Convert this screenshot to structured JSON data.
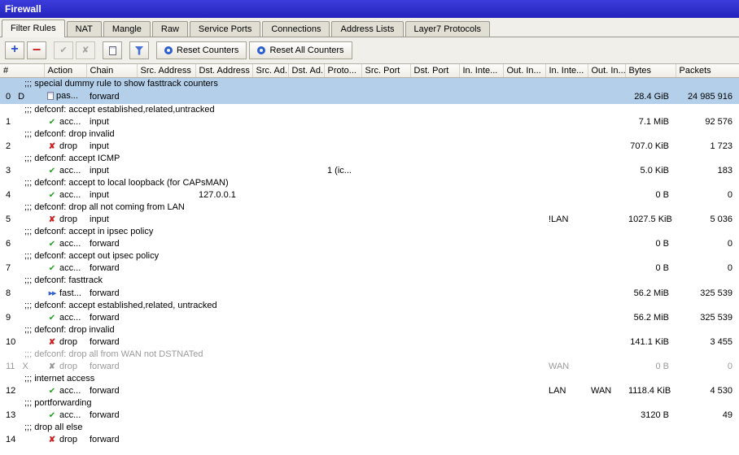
{
  "window": {
    "title": "Firewall"
  },
  "colors": {
    "titlebar": "#2e2ed0",
    "selection": "#b3cfe9",
    "accept_green": "#21a121",
    "drop_red": "#cf2020",
    "fasttrack_blue": "#2f62cf",
    "disabled_text": "#9a9a9a"
  },
  "tabs": [
    {
      "label": "Filter Rules",
      "active": true
    },
    {
      "label": "NAT",
      "active": false
    },
    {
      "label": "Mangle",
      "active": false
    },
    {
      "label": "Raw",
      "active": false
    },
    {
      "label": "Service Ports",
      "active": false
    },
    {
      "label": "Connections",
      "active": false
    },
    {
      "label": "Address Lists",
      "active": false
    },
    {
      "label": "Layer7 Protocols",
      "active": false
    }
  ],
  "toolbar": {
    "buttons": [
      {
        "name": "add",
        "icon": "plus-icon",
        "enabled": true
      },
      {
        "name": "remove",
        "icon": "minus-icon",
        "enabled": true
      },
      {
        "name": "enable",
        "icon": "check-icon",
        "enabled": false
      },
      {
        "name": "disable",
        "icon": "x-icon",
        "enabled": false
      },
      {
        "name": "copy",
        "icon": "copy-icon",
        "enabled": true
      },
      {
        "name": "filter",
        "icon": "funnel-icon",
        "enabled": true
      }
    ],
    "reset_counters_label": "Reset Counters",
    "reset_all_counters_label": "Reset All Counters"
  },
  "table": {
    "columns": [
      "#",
      "Action",
      "Chain",
      "Src. Address",
      "Dst. Address",
      "Src. Ad...",
      "Dst. Ad...",
      "Proto...",
      "Src. Port",
      "Dst. Port",
      "In. Inte...",
      "Out. In...",
      "In. Inte...",
      "Out. In...",
      "Bytes",
      "Packets"
    ],
    "rows": [
      {
        "type": "comment",
        "text": ";;; special dummy rule to show fasttrack counters",
        "selected": true
      },
      {
        "type": "rule",
        "num": "0",
        "flag": "D",
        "action": "pas...",
        "action_icon": "passthrough",
        "chain": "forward",
        "bytes": "28.4 GiB",
        "packets": "24 985 916",
        "selected": true
      },
      {
        "type": "comment",
        "text": ";;; defconf: accept established,related,untracked"
      },
      {
        "type": "rule",
        "num": "1",
        "action": "acc...",
        "action_icon": "accept",
        "chain": "input",
        "bytes": "7.1 MiB",
        "packets": "92 576"
      },
      {
        "type": "comment",
        "text": ";;; defconf: drop invalid"
      },
      {
        "type": "rule",
        "num": "2",
        "action": "drop",
        "action_icon": "drop",
        "chain": "input",
        "bytes": "707.0 KiB",
        "packets": "1 723"
      },
      {
        "type": "comment",
        "text": ";;; defconf: accept ICMP"
      },
      {
        "type": "rule",
        "num": "3",
        "action": "acc...",
        "action_icon": "accept",
        "chain": "input",
        "protocol": "1 (ic...",
        "bytes": "5.0 KiB",
        "packets": "183"
      },
      {
        "type": "comment",
        "text": ";;; defconf: accept to local loopback (for CAPsMAN)"
      },
      {
        "type": "rule",
        "num": "4",
        "action": "acc...",
        "action_icon": "accept",
        "chain": "input",
        "dst_address": "127.0.0.1",
        "bytes": "0 B",
        "packets": "0"
      },
      {
        "type": "comment",
        "text": ";;; defconf: drop all not coming from LAN"
      },
      {
        "type": "rule",
        "num": "5",
        "action": "drop",
        "action_icon": "drop",
        "chain": "input",
        "in_interface_list": "!LAN",
        "bytes": "1027.5 KiB",
        "packets": "5 036"
      },
      {
        "type": "comment",
        "text": ";;; defconf: accept in ipsec policy"
      },
      {
        "type": "rule",
        "num": "6",
        "action": "acc...",
        "action_icon": "accept",
        "chain": "forward",
        "bytes": "0 B",
        "packets": "0"
      },
      {
        "type": "comment",
        "text": ";;; defconf: accept out ipsec policy"
      },
      {
        "type": "rule",
        "num": "7",
        "action": "acc...",
        "action_icon": "accept",
        "chain": "forward",
        "bytes": "0 B",
        "packets": "0"
      },
      {
        "type": "comment",
        "text": ";;; defconf: fasttrack"
      },
      {
        "type": "rule",
        "num": "8",
        "action": "fast...",
        "action_icon": "fasttrack",
        "chain": "forward",
        "bytes": "56.2 MiB",
        "packets": "325 539"
      },
      {
        "type": "comment",
        "text": ";;; defconf: accept established,related, untracked"
      },
      {
        "type": "rule",
        "num": "9",
        "action": "acc...",
        "action_icon": "accept",
        "chain": "forward",
        "bytes": "56.2 MiB",
        "packets": "325 539"
      },
      {
        "type": "comment",
        "text": ";;; defconf: drop invalid"
      },
      {
        "type": "rule",
        "num": "10",
        "action": "drop",
        "action_icon": "drop",
        "chain": "forward",
        "bytes": "141.1 KiB",
        "packets": "3 455"
      },
      {
        "type": "comment",
        "text": ";;; defconf: drop all from WAN not DSTNATed",
        "disabled": true
      },
      {
        "type": "rule",
        "num": "11",
        "flag": "X",
        "action": "drop",
        "action_icon": "drop",
        "chain": "forward",
        "in_interface_list": "WAN",
        "bytes": "0 B",
        "packets": "0",
        "disabled": true
      },
      {
        "type": "comment",
        "text": ";;; internet access"
      },
      {
        "type": "rule",
        "num": "12",
        "action": "acc...",
        "action_icon": "accept",
        "chain": "forward",
        "in_interface_list": "LAN",
        "out_interface_list": "WAN",
        "bytes": "1118.4 KiB",
        "packets": "4 530"
      },
      {
        "type": "comment",
        "text": ";;; portforwarding"
      },
      {
        "type": "rule",
        "num": "13",
        "action": "acc...",
        "action_icon": "accept",
        "chain": "forward",
        "bytes": "3120 B",
        "packets": "49"
      },
      {
        "type": "comment",
        "text": ";;; drop all else"
      },
      {
        "type": "rule",
        "num": "14",
        "action": "drop",
        "action_icon": "drop",
        "chain": "forward",
        "bytes": "",
        "packets": ""
      }
    ]
  }
}
